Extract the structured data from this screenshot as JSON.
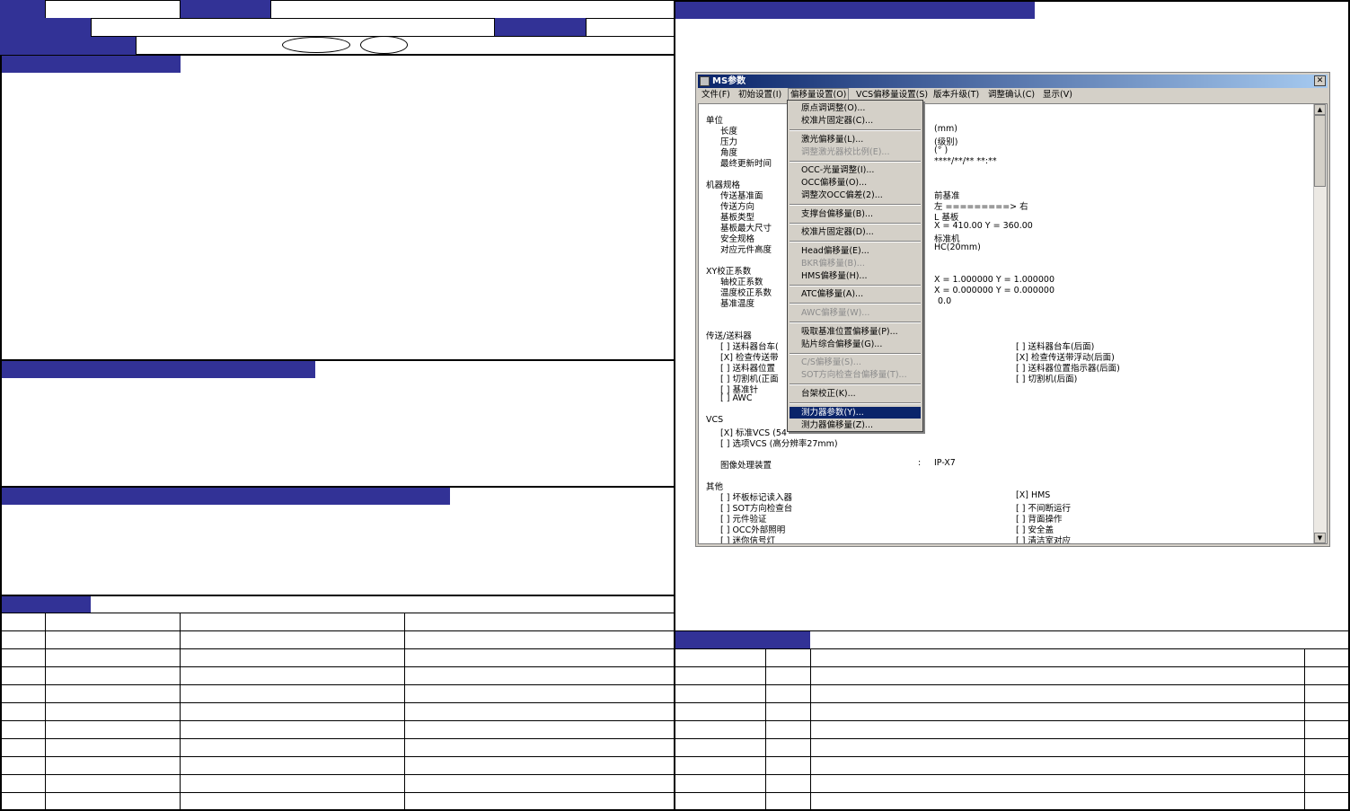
{
  "window": {
    "title": "MS参数",
    "close_glyph": "✕",
    "menu": [
      "文件(F)",
      "初始设置(I)",
      "偏移量设置(O)",
      "VCS偏移量设置(S)",
      "版本升级(T)",
      "调整确认(C)",
      "显示(V)"
    ]
  },
  "dropdown_items": [
    {
      "label": "原点调调整(O)...",
      "state": "normal"
    },
    {
      "label": "校准片固定器(C)...",
      "state": "normal"
    },
    {
      "label": "激光偏移量(L)...",
      "state": "normal"
    },
    {
      "label": "调整激光器校比例(E)...",
      "state": "disabled"
    },
    {
      "label": "OCC-光量调整(I)...",
      "state": "normal"
    },
    {
      "label": "OCC偏移量(O)...",
      "state": "normal"
    },
    {
      "label": "调整次OCC偏差(2)...",
      "state": "normal"
    },
    {
      "label": "支撑台偏移量(B)...",
      "state": "normal"
    },
    {
      "label": "校准片固定器(D)...",
      "state": "normal"
    },
    {
      "label": "Head偏移量(E)...",
      "state": "normal"
    },
    {
      "label": "BKR偏移量(B)...",
      "state": "disabled"
    },
    {
      "label": "HMS偏移量(H)...",
      "state": "normal"
    },
    {
      "label": "ATC偏移量(A)...",
      "state": "normal"
    },
    {
      "label": "AWC偏移量(W)...",
      "state": "disabled"
    },
    {
      "label": "吸取基准位置偏移量(P)...",
      "state": "normal"
    },
    {
      "label": "贴片综合偏移量(G)...",
      "state": "normal"
    },
    {
      "label": "C/S偏移量(S)...",
      "state": "disabled"
    },
    {
      "label": "SOT方向检查台偏移量(T)...",
      "state": "disabled"
    },
    {
      "label": "台架校正(K)...",
      "state": "normal"
    },
    {
      "label": "测力器参数(Y)...",
      "state": "selected"
    },
    {
      "label": "测力器偏移量(Z)...",
      "state": "normal"
    }
  ],
  "content": {
    "units_header": "单位",
    "units": [
      {
        "label": "长度",
        "value": "(mm)"
      },
      {
        "label": "压力",
        "value": "(级别)"
      },
      {
        "label": "角度",
        "value": "(° )"
      },
      {
        "label": "最终更新时间",
        "value": "****/**/** **:**"
      }
    ],
    "machine_header": "机器规格",
    "machine": [
      {
        "label": "传送基准面",
        "value": "前基准"
      },
      {
        "label": "传送方向",
        "value": "左 =========> 右"
      },
      {
        "label": "基板类型",
        "value": "L 基板"
      },
      {
        "label": "基板最大尺寸",
        "value": "X =   410.00   Y =   360.00"
      },
      {
        "label": "安全规格",
        "value": "标准机"
      },
      {
        "label": "对应元件高度",
        "value": "HC(20mm)"
      }
    ],
    "xy_header": "XY校正系数",
    "xy": [
      {
        "label": "轴校正系数",
        "value": "X = 1.000000   Y = 1.000000"
      },
      {
        "label": "温度校正系数",
        "value": "X = 0.000000   Y = 0.000000"
      },
      {
        "label": "基准温度",
        "value": "0.0"
      }
    ],
    "feeder_header": "传送/送料器",
    "feeder_left": [
      "[  ] 送料器台车(",
      "[X] 检查传送带",
      "[  ] 送料器位置",
      "[  ] 切割机(正面",
      "[  ] 基准针",
      "[  ] AWC"
    ],
    "feeder_right": [
      "[  ] 送料器台车(后面)",
      "[X] 检查传送带浮动(后面)",
      "[  ] 送料器位置指示器(后面)",
      "[  ] 切割机(后面)"
    ],
    "vcs_header": "VCS",
    "vcs": [
      "[X] 标准VCS (54",
      "[  ] 选项VCS (高分辨率27mm)"
    ],
    "image_label": "图像处理装置",
    "image_colon": ":",
    "image_value": "IP-X7",
    "other_header": "其他",
    "other_left": [
      "[  ] 坏板标记读入器",
      "[  ] SOT方向检查台",
      "[  ] 元件验证",
      "[  ] OCC外部照明",
      "[  ] 迷你信号灯"
    ],
    "other_right": [
      "[X] HMS",
      "[  ] 不间断运行",
      "[  ] 背面操作",
      "[  ] 安全盖",
      "[  ] 清洁室对应"
    ]
  }
}
